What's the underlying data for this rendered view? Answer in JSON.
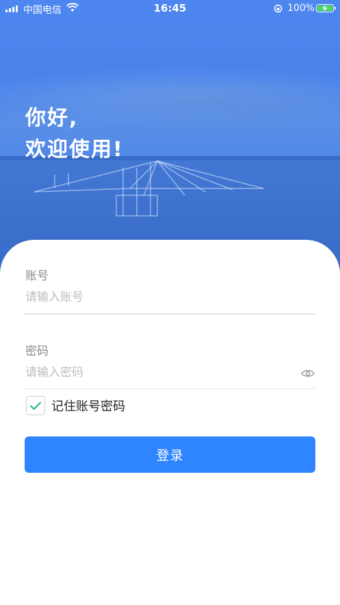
{
  "status_bar": {
    "carrier": "中国电信",
    "time": "16:45",
    "battery": "100%"
  },
  "greeting": {
    "line1": "你好,",
    "line2": "欢迎使用!"
  },
  "form": {
    "account_label": "账号",
    "account_placeholder": "请输入账号",
    "account_value": "",
    "password_label": "密码",
    "password_placeholder": "请输入密码",
    "password_value": "",
    "remember_label": "记住账号密码",
    "remember_checked": true,
    "login_label": "登录"
  },
  "icons": {
    "password_toggle": "eye-icon",
    "checkbox_mark": "checkmark-icon"
  },
  "colors": {
    "primary": "#2f84ff",
    "hero": "#4a82ea",
    "check": "#20b27a"
  }
}
